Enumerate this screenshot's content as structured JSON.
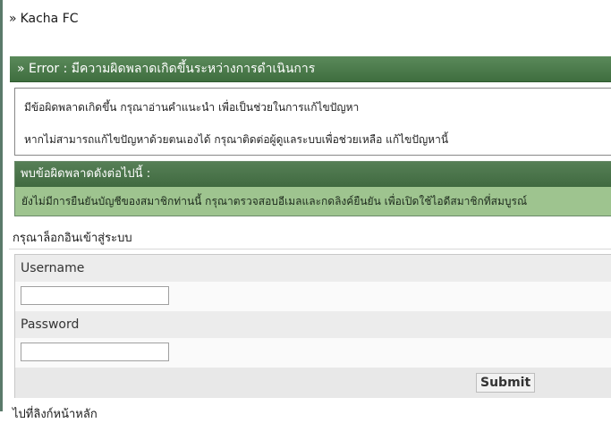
{
  "site": {
    "title": "Kacha FC",
    "chevron": "»"
  },
  "error": {
    "header": "» Error : มีความผิดพลาดเกิดขึ้นระหว่างการดำเนินการ",
    "line1": "มีข้อผิดพลาดเกิดขึ้น กรุณาอ่านคำแนะนำ เพื่อเป็นช่วยในการแก้ไขปัญหา",
    "line2": "หากไม่สามารถแก้ไขปัญหาด้วยตนเองได้ กรุณาติดต่อผู้ดูแลระบบเพื่อช่วยเหลือ แก้ไขปัญหานี้"
  },
  "found": {
    "header": "พบข้อผิดพลาดดังต่อไปนี้ :",
    "message": "ยังไม่มีการยืนยันบัญชีของสมาชิกท่านนี้ กรุณาตรวจสอบอีเมลและกดลิงค์ยืนยัน เพื่อเปิดใช้ไอดีสมาชิกที่สมบูรณ์"
  },
  "login": {
    "prompt": "กรุณาล็อกอินเข้าสู่ระบบ",
    "username_label": "Username",
    "username_value": "",
    "password_label": "Password",
    "password_value": "",
    "submit_label": "Submit"
  },
  "footer": {
    "cut_text": "ไปที่ลิงก์หน้าหลัก"
  },
  "colors": {
    "header_green": "#4a7a4a",
    "message_green": "#9ec48f"
  }
}
